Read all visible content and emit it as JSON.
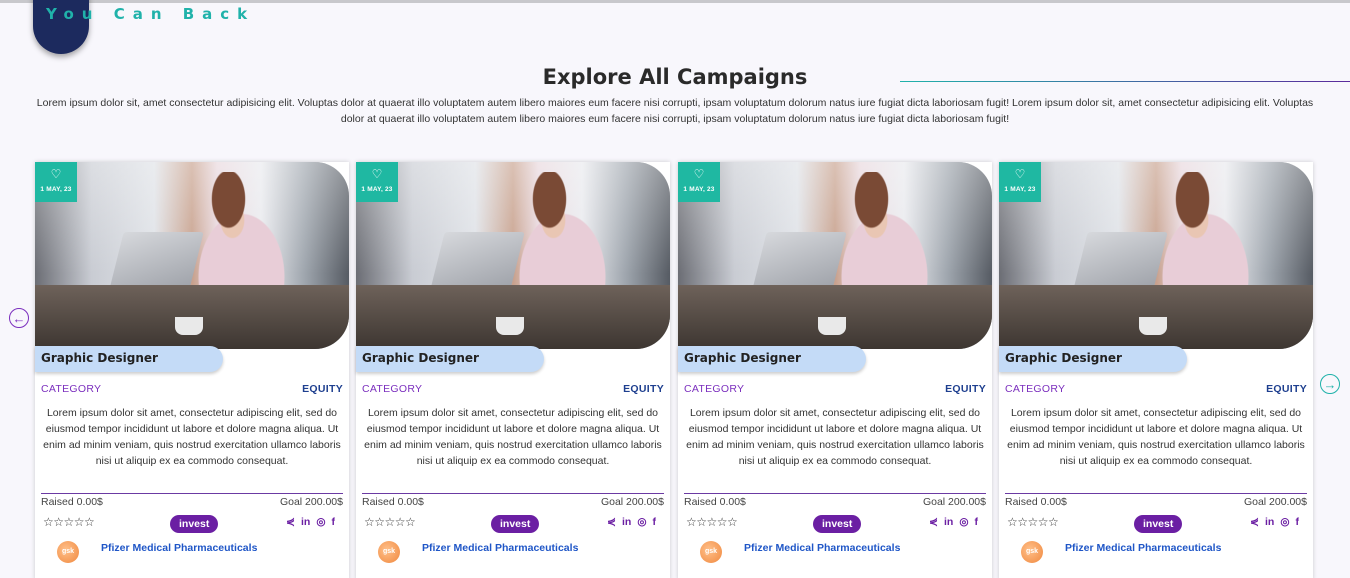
{
  "brand": {
    "name": "You Can Back"
  },
  "section": {
    "title": "Explore All Campaigns",
    "intro": "Lorem ipsum dolor sit, amet consectetur adipisicing elit. Voluptas dolor at quaerat illo voluptatem autem libero maiores eum facere nisi corrupti, ipsam voluptatum dolorum natus iure fugiat dicta laboriosam fugit! Lorem ipsum dolor sit, amet consectetur adipisicing elit. Voluptas dolor at quaerat illo voluptatem autem libero maiores eum facere nisi corrupti, ipsam voluptatum dolorum natus iure fugiat dicta laboriosam fugit!"
  },
  "carousel": {
    "prev_icon": "←",
    "next_icon": "→"
  },
  "cards": [
    {
      "date": "1 MAY, 23",
      "heart_icon": "♡",
      "title": "Graphic Designer",
      "category": "CATEGORY",
      "type": "EQUITY",
      "description": "Lorem ipsum dolor sit amet, consectetur adipiscing elit, sed do eiusmod tempor incididunt ut labore et dolore magna aliqua. Ut enim ad minim veniam, quis nostrud exercitation ullamco laboris nisi ut aliquip ex ea commodo consequat.",
      "raised": "Raised 0.00$",
      "goal": "Goal 200.00$",
      "stars": "☆☆☆☆☆",
      "rating": 0,
      "invest_label": "invest",
      "share_icon": "⋞",
      "linkedin_icon": "in",
      "instagram_icon": "◎",
      "facebook_icon": "f",
      "sponsor_logo": "gsk",
      "sponsor": "Pfizer Medical Pharmaceuticals"
    },
    {
      "date": "1 MAY, 23",
      "heart_icon": "♡",
      "title": "Graphic Designer",
      "category": "CATEGORY",
      "type": "EQUITY",
      "description": "Lorem ipsum dolor sit amet, consectetur adipiscing elit, sed do eiusmod tempor incididunt ut labore et dolore magna aliqua. Ut enim ad minim veniam, quis nostrud exercitation ullamco laboris nisi ut aliquip ex ea commodo consequat.",
      "raised": "Raised 0.00$",
      "goal": "Goal 200.00$",
      "stars": "☆☆☆☆☆",
      "rating": 0,
      "invest_label": "invest",
      "share_icon": "⋞",
      "linkedin_icon": "in",
      "instagram_icon": "◎",
      "facebook_icon": "f",
      "sponsor_logo": "gsk",
      "sponsor": "Pfizer Medical Pharmaceuticals"
    },
    {
      "date": "1 MAY, 23",
      "heart_icon": "♡",
      "title": "Graphic Designer",
      "category": "CATEGORY",
      "type": "EQUITY",
      "description": "Lorem ipsum dolor sit amet, consectetur adipiscing elit, sed do eiusmod tempor incididunt ut labore et dolore magna aliqua. Ut enim ad minim veniam, quis nostrud exercitation ullamco laboris nisi ut aliquip ex ea commodo consequat.",
      "raised": "Raised 0.00$",
      "goal": "Goal 200.00$",
      "stars": "☆☆☆☆☆",
      "rating": 0,
      "invest_label": "invest",
      "share_icon": "⋞",
      "linkedin_icon": "in",
      "instagram_icon": "◎",
      "facebook_icon": "f",
      "sponsor_logo": "gsk",
      "sponsor": "Pfizer Medical Pharmaceuticals"
    },
    {
      "date": "1 MAY, 23",
      "heart_icon": "♡",
      "title": "Graphic Designer",
      "category": "CATEGORY",
      "type": "EQUITY",
      "description": "Lorem ipsum dolor sit amet, consectetur adipiscing elit, sed do eiusmod tempor incididunt ut labore et dolore magna aliqua. Ut enim ad minim veniam, quis nostrud exercitation ullamco laboris nisi ut aliquip ex ea commodo consequat.",
      "raised": "Raised 0.00$",
      "goal": "Goal 200.00$",
      "stars": "☆☆☆☆☆",
      "rating": 0,
      "invest_label": "invest",
      "share_icon": "⋞",
      "linkedin_icon": "in",
      "instagram_icon": "◎",
      "facebook_icon": "f",
      "sponsor_logo": "gsk",
      "sponsor": "Pfizer Medical Pharmaceuticals"
    }
  ],
  "colors": {
    "accent_teal": "#1fb8a2",
    "accent_purple": "#6b1fa3",
    "navy": "#1c2a5e",
    "tag_blue": "#c4dbf7",
    "link_blue": "#1f56c7"
  }
}
